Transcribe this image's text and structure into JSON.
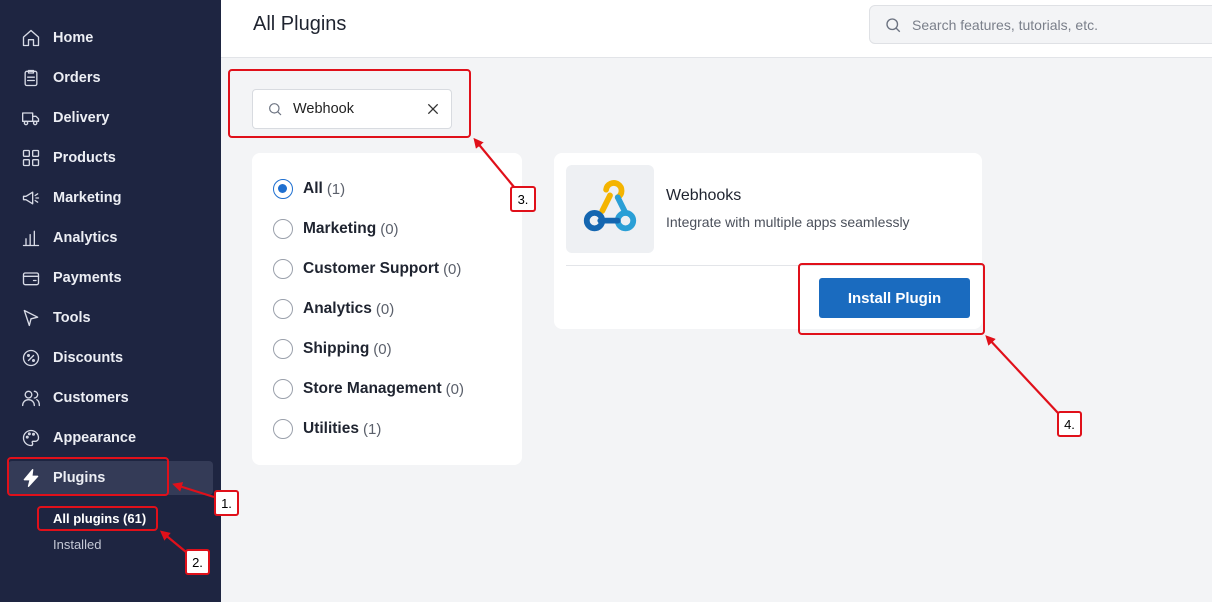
{
  "sidebar": {
    "items": [
      {
        "label": "Home",
        "icon": "home-icon"
      },
      {
        "label": "Orders",
        "icon": "orders-icon"
      },
      {
        "label": "Delivery",
        "icon": "truck-icon"
      },
      {
        "label": "Products",
        "icon": "grid-icon"
      },
      {
        "label": "Marketing",
        "icon": "megaphone-icon"
      },
      {
        "label": "Analytics",
        "icon": "bar-chart-icon"
      },
      {
        "label": "Payments",
        "icon": "wallet-icon"
      },
      {
        "label": "Tools",
        "icon": "cursor-icon"
      },
      {
        "label": "Discounts",
        "icon": "discount-icon"
      },
      {
        "label": "Customers",
        "icon": "users-icon"
      },
      {
        "label": "Appearance",
        "icon": "palette-icon"
      },
      {
        "label": "Plugins",
        "icon": "lightning-icon"
      }
    ],
    "sub_items": [
      {
        "label": "All plugins (61)"
      },
      {
        "label": "Installed"
      }
    ]
  },
  "header": {
    "title": "All Plugins",
    "search_placeholder": "Search features, tutorials, etc."
  },
  "plugin_search": {
    "value": "Webhook"
  },
  "categories": [
    {
      "name": "All",
      "count": "(1)",
      "selected": true
    },
    {
      "name": "Marketing",
      "count": "(0)",
      "selected": false
    },
    {
      "name": "Customer Support",
      "count": "(0)",
      "selected": false
    },
    {
      "name": "Analytics",
      "count": "(0)",
      "selected": false
    },
    {
      "name": "Shipping",
      "count": "(0)",
      "selected": false
    },
    {
      "name": "Store Management",
      "count": "(0)",
      "selected": false
    },
    {
      "name": "Utilities",
      "count": "(1)",
      "selected": false
    }
  ],
  "plugin_card": {
    "name": "Webhooks",
    "description": "Integrate with multiple apps seamlessly",
    "install_label": "Install Plugin"
  },
  "annotations": [
    "1.",
    "2.",
    "3.",
    "4."
  ],
  "colors": {
    "sidebar_bg": "#1e2541",
    "accent": "#1a6bbf",
    "annotation": "#e0101a"
  }
}
